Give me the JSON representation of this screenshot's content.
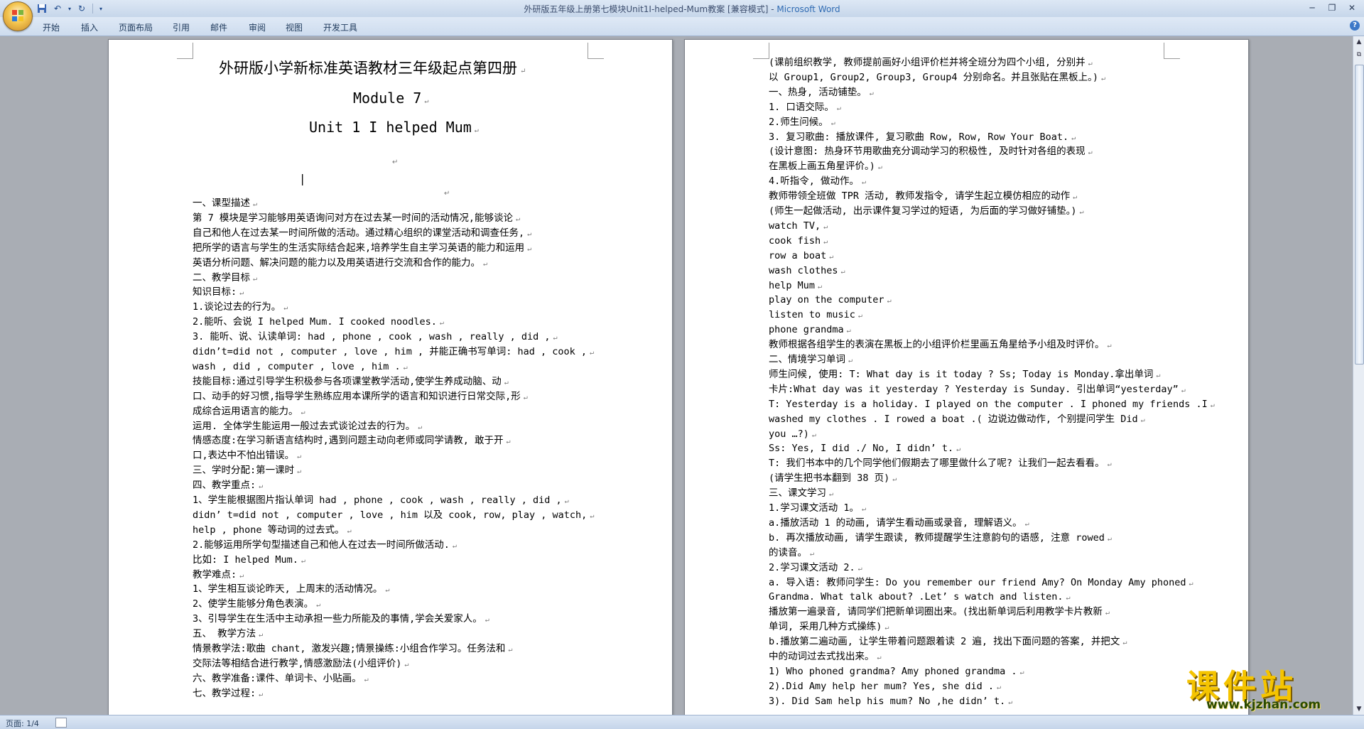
{
  "window": {
    "title": "外研版五年级上册第七模块Unit1I-helped-Mum教案 [兼容模式] - ",
    "app_name": "Microsoft Word"
  },
  "ribbon_tabs": [
    "开始",
    "插入",
    "页面布局",
    "引用",
    "邮件",
    "审阅",
    "视图",
    "开发工具"
  ],
  "page1": {
    "title": "外研版小学新标准英语教材三年级起点第四册",
    "module": "Module  7",
    "unit": "Unit 1 I helped Mum",
    "lines": [
      "一、课型描述",
      "   第 7 模块是学习能够用英语询问对方在过去某一时间的活动情况,能够谈论",
      "自己和他人在过去某一时间所做的活动。通过精心组织的课堂活动和调查任务,",
      "把所学的语言与学生的生活实际结合起来,培养学生自主学习英语的能力和运用",
      "英语分析问题、解决问题的能力以及用英语进行交流和合作的能力。",
      "   二、教学目标",
      "   知识目标:",
      "   1.谈论过去的行为。",
      "   2.能听、会说 I helped Mum. I cooked noodles.",
      "   3. 能听、说、认读单词: had , phone , cook , wash , really , did ,",
      "didn’t=did not , computer , love , him , 并能正确书写单词: had , cook ,",
      "     wash , did , computer , love , him .",
      "   技能目标:通过引导学生积极参与各项课堂教学活动,使学生养成动脑、动",
      "口、动手的好习惯,指导学生熟练应用本课所学的语言和知识进行日常交际,形",
      "成综合运用语言的能力。",
      "运用. 全体学生能运用一般过去式谈论过去的行为。",
      "   情感态度:在学习新语言结构时,遇到问题主动向老师或同学请教, 敢于开",
      "口,表达中不怕出错误。",
      "   三、学时分配:第一课时",
      "   四、教学重点:",
      "   1、学生能根据图片指认单词 had , phone , cook , wash , really , did ,",
      "didn’ t=did not , computer , love , him 以及 cook,  row, play , watch,",
      "help , phone  等动词的过去式。",
      "   2.能够运用所学句型描述自己和他人在过去一时间所做活动.",
      " 比如: I helped Mum.",
      "   教学难点:",
      "   1、学生相互谈论昨天, 上周末的活动情况。",
      "   2、使学生能够分角色表演。",
      "   3、引导学生在生活中主动承担一些力所能及的事情,学会关爱家人。",
      "   五、   教学方法",
      "  情景教学法:歌曲 chant, 激发兴趣;情景操练:小组合作学习。任务法和",
      "交际法等相结合进行教学,情感激励法(小组评价)",
      "   六、教学准备:课件、单词卡、小贴画。",
      "   七、教学过程:"
    ]
  },
  "page2": {
    "lines": [
      "   (课前组织教学, 教师提前画好小组评价栏并将全班分为四个小组, 分别并",
      "以 Group1, Group2, Group3, Group4 分别命名。并且张贴在黑板上。)",
      "   一、热身, 活动铺垫。",
      "   1. 口语交际。",
      "   2.师生问候。",
      "   3. 复习歌曲: 播放课件, 复习歌曲 Row, Row, Row Your Boat.",
      "   (设计意图: 热身环节用歌曲充分调动学习的积极性, 及时针对各组的表现",
      "在黑板上画五角星评价。)",
      "    4.听指令, 做动作。",
      "教师带领全班做 TPR 活动, 教师发指令, 请学生起立模仿相应的动作",
      "(师生一起做活动, 出示课件复习学过的短语, 为后面的学习做好铺垫。)",
      " watch TV,",
      " cook fish",
      " row a boat",
      " wash clothes",
      " help Mum",
      " play on the computer",
      " listen to music",
      "phone grandma",
      "教师根据各组学生的表演在黑板上的小组评价栏里画五角星给予小组及时评价。",
      "    二、情境学习单词",
      "师生问候, 使用: T: What day is it today ? Ss; Today is Monday.拿出单词",
      "卡片:What day was it yesterday ? Yesterday is Sunday.  引出单词“yesterday”",
      "T: Yesterday is a holiday. I played on the computer . I phoned my friends .I",
      "washed my clothes . I rowed a boat .( 边说边做动作, 个别提问学生 Did",
      "you  …?)",
      "Ss: Yes, I did ./ No, I didn’ t.",
      "T:  我们书本中的几个同学他们假期去了哪里做什么了呢? 让我们一起去看看。",
      "(请学生把书本翻到 38 页)",
      "    三、课文学习",
      "   1.学习课文活动 1。",
      "    a.播放活动 1 的动画, 请学生看动画或录音, 理解语义。",
      "    b. 再次播放动画, 请学生跟读, 教师提醒学生注意韵句的语感, 注意 rowed",
      "的读音。",
      "    2.学习课文活动 2.",
      "a. 导入语: 教师问学生: Do you remember our friend Amy? On Monday Amy phoned",
      "Grandma. What talk about? .Let’ s watch and listen.",
      "播放第一遍录音, 请同学们把新单词圈出来。(找出新单词后利用教学卡片教新",
      "单词, 采用几种方式操练)",
      "b.播放第二遍动画, 让学生带着问题跟着读 2 遍, 找出下面问题的答案, 并把文",
      "中的动词过去式找出来。",
      " 1) Who phoned grandma?  Amy phoned grandma .",
      "2).Did Amy help her mum? Yes, she did .",
      " 3). Did Sam help his mum? No ,he didn’ t."
    ]
  },
  "status": {
    "page": "页面: 1/4"
  },
  "watermark": {
    "title": "课件站",
    "url": "www.kjzhan.com"
  }
}
